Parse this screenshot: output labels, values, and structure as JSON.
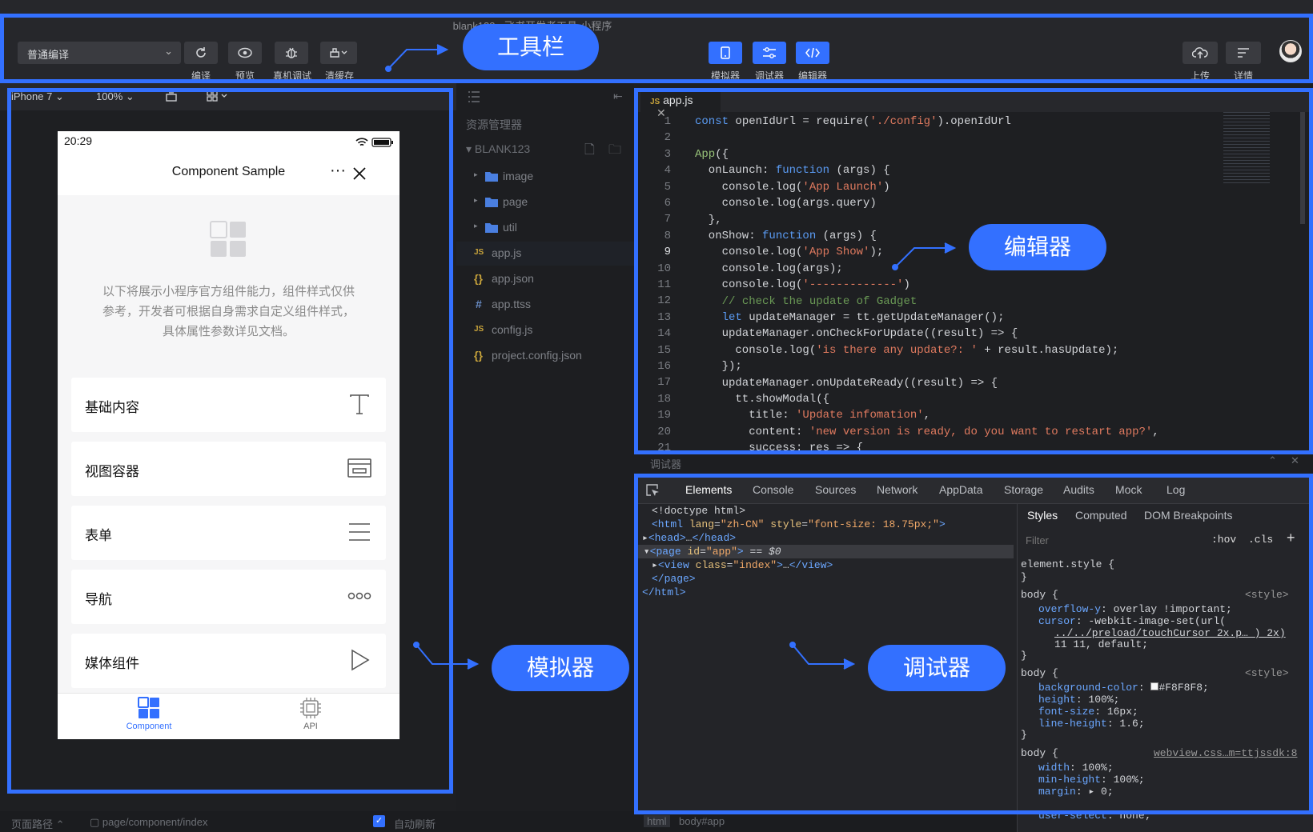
{
  "window_title": "blank123 - 飞书开发者工具-小程序",
  "toolbar": {
    "compile_mode": "普通编译",
    "buttons": [
      {
        "label": "编译",
        "icon": "refresh-icon"
      },
      {
        "label": "预览",
        "icon": "eye-icon"
      },
      {
        "label": "真机调试",
        "icon": "bug-icon"
      },
      {
        "label": "清缓存",
        "icon": "clean-icon"
      }
    ],
    "view_buttons": [
      {
        "label": "模拟器",
        "icon": "phone-icon"
      },
      {
        "label": "调试器",
        "icon": "sliders-icon"
      },
      {
        "label": "编辑器",
        "icon": "code-icon"
      }
    ],
    "right_buttons": [
      {
        "label": "上传",
        "icon": "upload-icon"
      },
      {
        "label": "详情",
        "icon": "details-icon"
      }
    ]
  },
  "callouts": {
    "toolbar": "工具栏",
    "editor": "编辑器",
    "simulator": "模拟器",
    "debugger": "调试器"
  },
  "simulator": {
    "device": "iPhone 7",
    "zoom": "100%",
    "phone": {
      "time": "20:29",
      "nav_title": "Component Sample",
      "intro_lines": [
        "以下将展示小程序官方组件能力，组件样式仅供",
        "参考，开发者可根据自身需求自定义组件样式，",
        "具体属性参数详见文档。"
      ],
      "cards": [
        {
          "label": "基础内容",
          "icon": "text-t-icon"
        },
        {
          "label": "视图容器",
          "icon": "container-icon"
        },
        {
          "label": "表单",
          "icon": "list-lines-icon"
        },
        {
          "label": "导航",
          "icon": "dots-icon"
        },
        {
          "label": "媒体组件",
          "icon": "play-icon"
        }
      ],
      "tabs": [
        {
          "label": "Component",
          "active": true
        },
        {
          "label": "API",
          "active": false
        }
      ]
    },
    "footer": {
      "path_label": "页面路径",
      "path": "page/component/index",
      "auto_refresh": "自动刷新"
    }
  },
  "explorer": {
    "title": "资源管理器",
    "project": "BLANK123",
    "items": [
      {
        "label": "image",
        "type": "folder"
      },
      {
        "label": "page",
        "type": "folder"
      },
      {
        "label": "util",
        "type": "folder"
      },
      {
        "label": "app.js",
        "type": "js"
      },
      {
        "label": "app.json",
        "type": "json"
      },
      {
        "label": "app.ttss",
        "type": "css"
      },
      {
        "label": "config.js",
        "type": "js"
      },
      {
        "label": "project.config.json",
        "type": "json"
      }
    ]
  },
  "editor": {
    "tab": "app.js",
    "line_numbers": [
      "1",
      "2",
      "3",
      "4",
      "5",
      "6",
      "7",
      "8",
      "9",
      "10",
      "11",
      "12",
      "13",
      "14",
      "15",
      "16",
      "17",
      "18",
      "19",
      "20",
      "21"
    ]
  },
  "debugger": {
    "panel_title": "调试器",
    "tabs": [
      "Elements",
      "Console",
      "Sources",
      "Network",
      "AppData",
      "Storage",
      "Audits",
      "Mock",
      "Log"
    ],
    "style_tabs": [
      "Styles",
      "Computed",
      "DOM Breakpoints"
    ],
    "filter_placeholder": "Filter",
    "hov": ":hov",
    "cls": ".cls",
    "breadcrumbs": [
      "html",
      "body#app"
    ]
  },
  "colors": {
    "accent": "#3370ff",
    "toolbar_bg": "#26272b",
    "editor_bg": "#1e1f22"
  }
}
